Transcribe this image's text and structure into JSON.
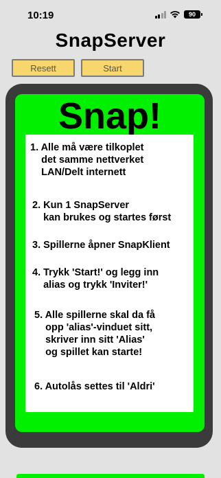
{
  "status_bar": {
    "time": "10:19",
    "battery": "90"
  },
  "app": {
    "title": "SnapServer",
    "buttons": {
      "reset": "Resett",
      "start": "Start"
    }
  },
  "panel": {
    "heading": "Snap!",
    "steps": [
      "1. Alle må være tilkoplet\n    det samme nettverket\n    LAN/Delt internett",
      "2. Kun 1 SnapServer\n    kan brukes og startes først",
      "3. Spillerne åpner SnapKlient",
      "4. Trykk 'Start!' og legg inn\n    alias og trykk 'Inviter!'",
      "5. Alle spillerne skal da få\n    opp 'alias'-vinduet sitt,\n    skriver inn sitt 'Alias'\n    og spillet kan starte!",
      "6. Autolås settes til 'Aldri'"
    ]
  },
  "colors": {
    "background": "#e2e2e2",
    "panel_green": "#00f000",
    "button_yellow": "#f8d66e",
    "frame_dark": "#3b3b3b"
  },
  "icons": [
    "signal-icon",
    "wifi-icon",
    "battery-icon"
  ]
}
